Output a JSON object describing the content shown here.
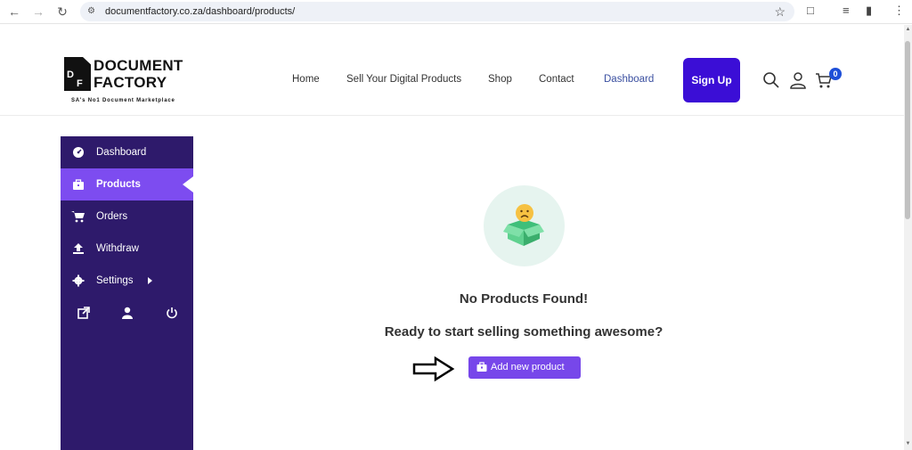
{
  "browser": {
    "url": "documentfactory.co.za/dashboard/products/"
  },
  "logo": {
    "line1": "DOCUMENT",
    "line2": "FACTORY",
    "mark_d": "D",
    "mark_f": "F",
    "tagline": "SA's No1 Document Marketplace"
  },
  "nav": {
    "items": [
      {
        "label": "Home"
      },
      {
        "label": "Sell Your Digital Products"
      },
      {
        "label": "Shop"
      },
      {
        "label": "Contact"
      },
      {
        "label": "Dashboard",
        "active": true
      }
    ],
    "signup_label": "Sign Up",
    "cart_count": "0"
  },
  "sidebar": {
    "items": [
      {
        "label": "Dashboard",
        "icon": "gauge-icon"
      },
      {
        "label": "Products",
        "icon": "briefcase-icon",
        "active": true
      },
      {
        "label": "Orders",
        "icon": "cart-icon"
      },
      {
        "label": "Withdraw",
        "icon": "upload-icon"
      },
      {
        "label": "Settings",
        "icon": "gear-icon"
      }
    ],
    "bottom_icons": [
      "external-link-icon",
      "user-icon",
      "power-icon"
    ]
  },
  "main": {
    "empty_title": "No Products Found!",
    "empty_subtitle": "Ready to start selling something awesome?",
    "add_button_label": "Add new product"
  },
  "colors": {
    "sidebar_bg": "#2e1a6b",
    "sidebar_active": "#7d4cf0",
    "signup_bg": "#3b0ed6",
    "add_button": "#7747ea",
    "nav_active": "#3a4fa0"
  }
}
